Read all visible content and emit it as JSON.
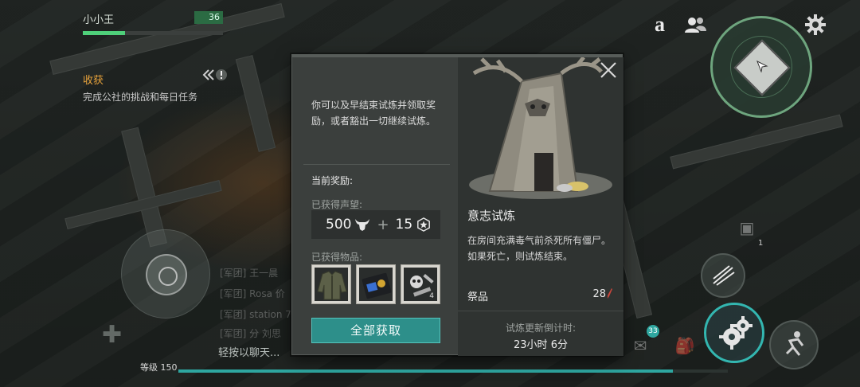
{
  "player": {
    "name": "小小王",
    "level": "36",
    "hp_fraction": 0.3
  },
  "quest": {
    "title": "收获",
    "description": "完成公社的挑战和每日任务"
  },
  "chat": {
    "prompt": "轻按以聊天...",
    "faded_lines": [
      "[军团] 王一晨",
      "[军团] Rosa 价",
      "[军团] station 7",
      "[军团] 分 刘思"
    ]
  },
  "xp": {
    "label": "等级 150",
    "fraction": 0.9
  },
  "hud": {
    "a_label": "a",
    "mail_count": "33",
    "ammo_count": "1"
  },
  "modal": {
    "intro": "你可以及早结束试炼并领取奖励，或者豁出一切继续试炼。",
    "reward_title": "当前奖励:",
    "reputation_label": "已获得声望:",
    "reputation_primary": "500",
    "reputation_secondary": "15",
    "plus": "+",
    "items_label": "已获得物品:",
    "items": [
      {
        "icon": "jacket-icon",
        "count": ""
      },
      {
        "icon": "id-card-icon",
        "count": ""
      },
      {
        "icon": "parts-icon",
        "count": "4"
      }
    ],
    "claim_label": "全部获取",
    "trial_name": "意志试炼",
    "trial_desc": "在房间充满毒气前杀死所有僵尸。如果死亡，则试炼结束。",
    "offering_label": "祭品",
    "offering_value": "28",
    "refresh_label": "试炼更新倒计时:",
    "refresh_value": "23小时 6分"
  },
  "colors": {
    "accent_teal": "#2d8f8a",
    "hp_green": "#4fd07a",
    "quest_orange": "#e8a33c"
  }
}
